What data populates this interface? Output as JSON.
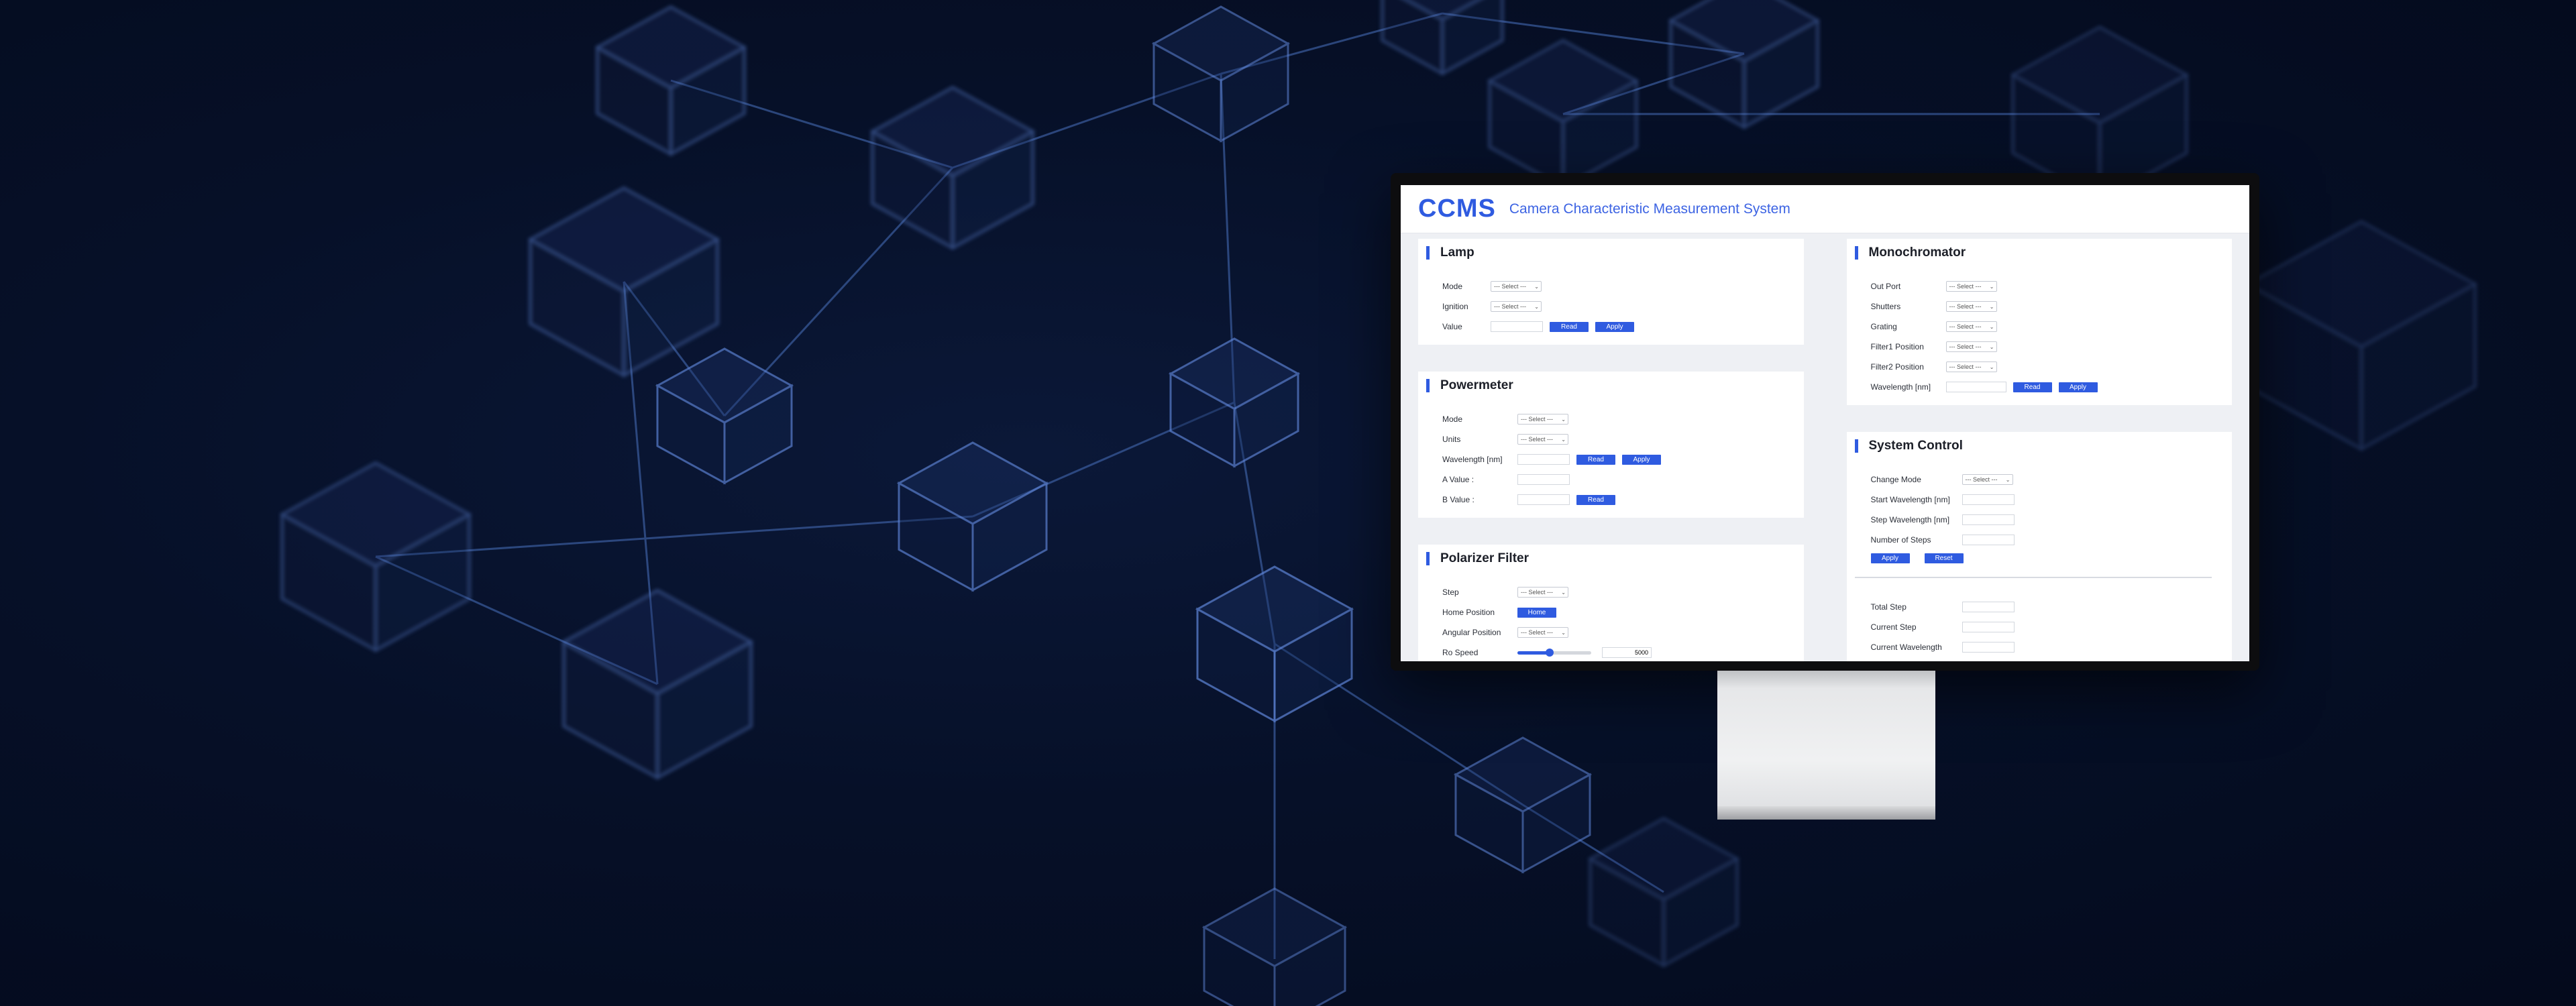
{
  "app": {
    "brand": "CCMS",
    "subtitle": "Camera Characteristic Measurement System"
  },
  "select_placeholder": "--- Select ---",
  "lamp": {
    "title": "Lamp",
    "mode_label": "Mode",
    "ignition_label": "Ignition",
    "value_label": "Value",
    "read_label": "Read",
    "apply_label": "Apply"
  },
  "powermeter": {
    "title": "Powermeter",
    "mode_label": "Mode",
    "units_label": "Units",
    "wavelength_label": "Wavelength [nm]",
    "a_value_label": "A Value :",
    "b_value_label": "B Value :",
    "read_label": "Read",
    "apply_label": "Apply"
  },
  "polarizer": {
    "title": "Polarizer Filter",
    "step_label": "Step",
    "home_position_label": "Home Position",
    "home_button": "Home",
    "angular_position_label": "Angular Position",
    "ro_speed_label": "Ro Speed",
    "ro_speed_value": "5000",
    "ro_speed_fraction": 0.44
  },
  "monochromator": {
    "title": "Monochromator",
    "out_port_label": "Out Port",
    "shutters_label": "Shutters",
    "grating_label": "Grating",
    "filter1_label": "Filter1 Position",
    "filter2_label": "Filter2 Position",
    "wavelength_label": "Wavelength [nm]",
    "read_label": "Read",
    "apply_label": "Apply"
  },
  "system_control": {
    "title": "System Control",
    "change_mode_label": "Change Mode",
    "start_wavelength_label": "Start Wavelength [nm]",
    "step_wavelength_label": "Step Wavelength [nm]",
    "number_of_steps_label": "Number of Steps",
    "apply_label": "Apply",
    "reset_label": "Reset",
    "total_step_label": "Total Step",
    "current_step_label": "Current Step",
    "current_wavelength_label": "Current Wavelength",
    "progress_start_fraction": 0.29,
    "progress_end_fraction": 0.49
  },
  "colors": {
    "accent": "#2f5be0",
    "background": "#061028",
    "panel": "#ffffff"
  }
}
